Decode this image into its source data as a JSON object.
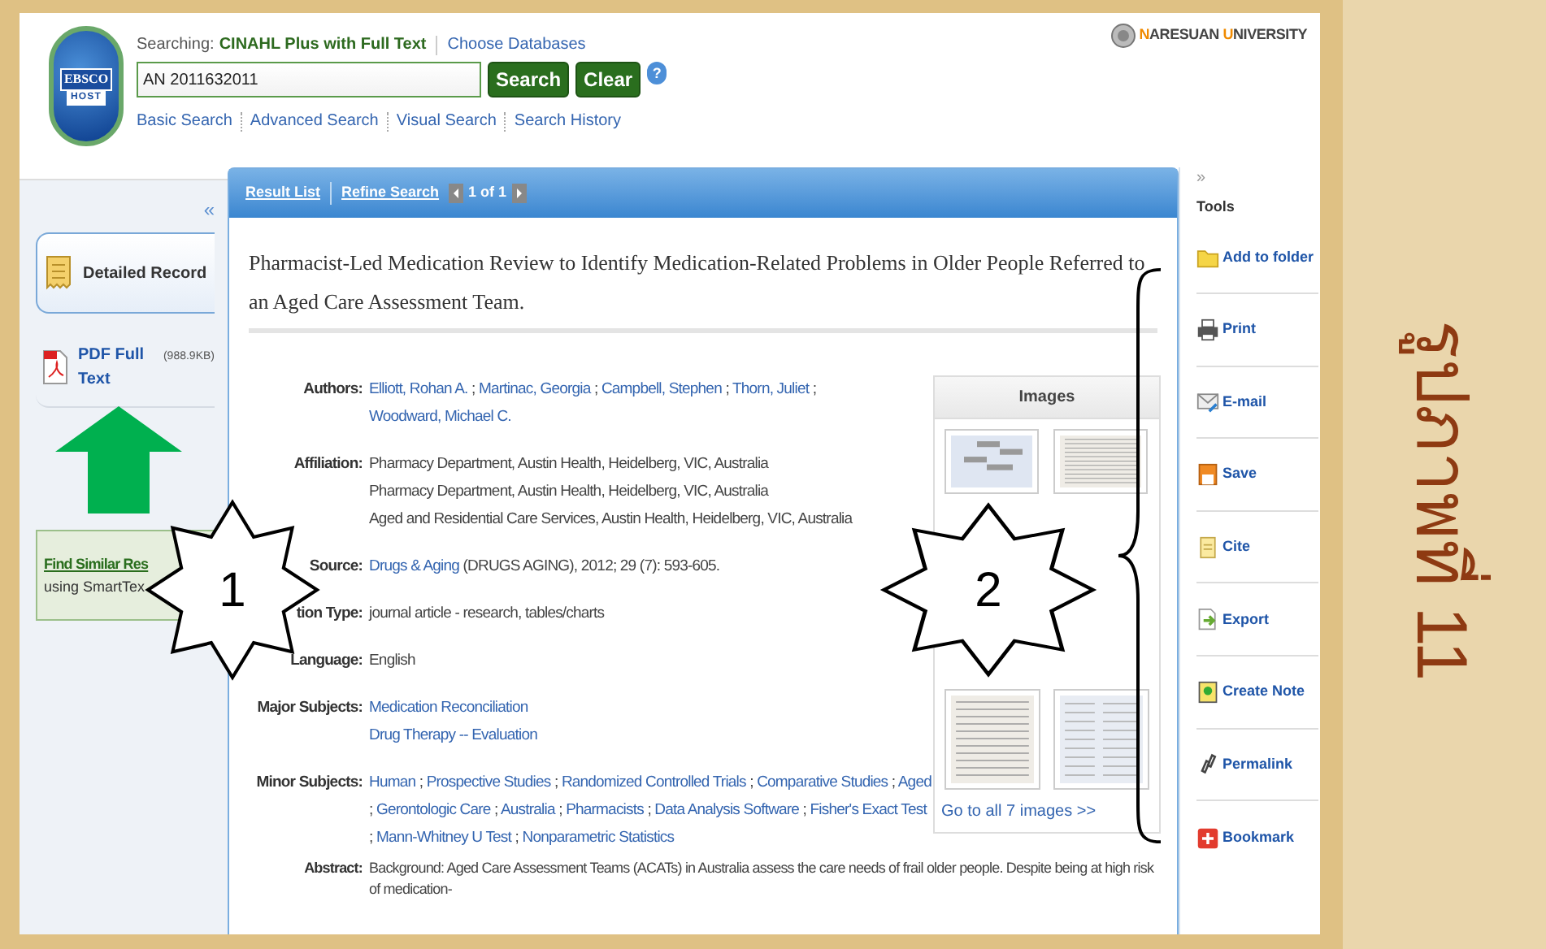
{
  "header": {
    "searching_label": "Searching:",
    "database": "CINAHL Plus with Full Text",
    "choose_databases": "Choose Databases",
    "logo_top": "EBSCO",
    "logo_bottom": "HOST",
    "search_value": "AN 2011632011",
    "search_button": "Search",
    "clear_button": "Clear",
    "help": "?",
    "links": [
      "Basic Search",
      "Advanced Search",
      "Visual Search",
      "Search History"
    ],
    "university": "NARESUAN UNIVERSITY"
  },
  "left_panel": {
    "collapse": "«",
    "items": [
      {
        "label": "Detailed Record",
        "kind": "record",
        "selected": true
      },
      {
        "label": "PDF Full Text",
        "size": "(988.9KB)",
        "kind": "pdf",
        "selected": false
      }
    ],
    "find_similar": {
      "title": "Find Similar Res",
      "subtitle": "using SmartTex"
    }
  },
  "record": {
    "nav": {
      "result_list": "Result List",
      "refine_search": "Refine Search",
      "pager": "1 of 1"
    },
    "title": "Pharmacist-Led Medication Review to Identify Medication-Related Problems in Older People Referred to an Aged Care Assessment Team.",
    "fields": [
      {
        "label": "Authors:",
        "kind": "links",
        "separator": ";",
        "values": [
          "Elliott, Rohan A.",
          "Martinac, Georgia",
          "Campbell, Stephen",
          "Thorn, Juliet",
          "Woodward, Michael C."
        ]
      },
      {
        "label": "Affiliation:",
        "kind": "lines",
        "values": [
          "Pharmacy Department, Austin Health, Heidelberg, VIC, Australia",
          "Pharmacy Department, Austin Health, Heidelberg, VIC, Australia",
          "Aged and Residential Care Services, Austin Health, Heidelberg, VIC, Australia"
        ]
      },
      {
        "label": "Source:",
        "kind": "source",
        "values": [
          "Drugs & Aging",
          "(DRUGS AGING), 2012; 29 (7): 593-605."
        ]
      },
      {
        "label": "tion Type:",
        "kind": "text",
        "values": [
          "journal article - research, tables/charts"
        ]
      },
      {
        "label": "Language:",
        "kind": "text",
        "values": [
          "English"
        ]
      },
      {
        "label": "Major Subjects:",
        "kind": "link_lines",
        "values": [
          "Medication Reconciliation",
          "Drug Therapy -- Evaluation"
        ]
      },
      {
        "label": "Minor Subjects:",
        "kind": "links",
        "separator": ";",
        "values": [
          "Human",
          "Prospective Studies",
          "Randomized Controlled Trials",
          "Comparative Studies",
          "Aged",
          "Gerontologic Care",
          "Australia",
          "Pharmacists",
          "Data Analysis Software",
          "Fisher's Exact Test",
          "Mann-Whitney U Test",
          "Nonparametric Statistics"
        ]
      },
      {
        "label": "Abstract:",
        "kind": "text",
        "values": [
          "Background: Aged Care Assessment Teams (ACATs) in Australia assess the care needs of frail older people. Despite being at high risk of medication-"
        ]
      }
    ],
    "images": {
      "title": "Images",
      "thumbnails": [
        {
          "kind": "flowchart"
        },
        {
          "kind": "table"
        },
        {
          "kind": "table"
        },
        {
          "kind": "form"
        }
      ],
      "link": "Go to all 7 images >>"
    }
  },
  "tools": {
    "expand": "»",
    "title": "Tools",
    "items": [
      {
        "label": "Add to folder",
        "kind": "folder"
      },
      {
        "label": "Print",
        "kind": "print"
      },
      {
        "label": "E-mail",
        "kind": "email"
      },
      {
        "label": "Save",
        "kind": "save"
      },
      {
        "label": "Cite",
        "kind": "cite"
      },
      {
        "label": "Export",
        "kind": "export"
      },
      {
        "label": "Create Note",
        "kind": "note"
      },
      {
        "label": "Permalink",
        "kind": "permalink"
      },
      {
        "label": "Bookmark",
        "kind": "bookmark"
      }
    ]
  },
  "callouts": [
    "1",
    "2"
  ],
  "caption": "รูปภาพที่ 11"
}
